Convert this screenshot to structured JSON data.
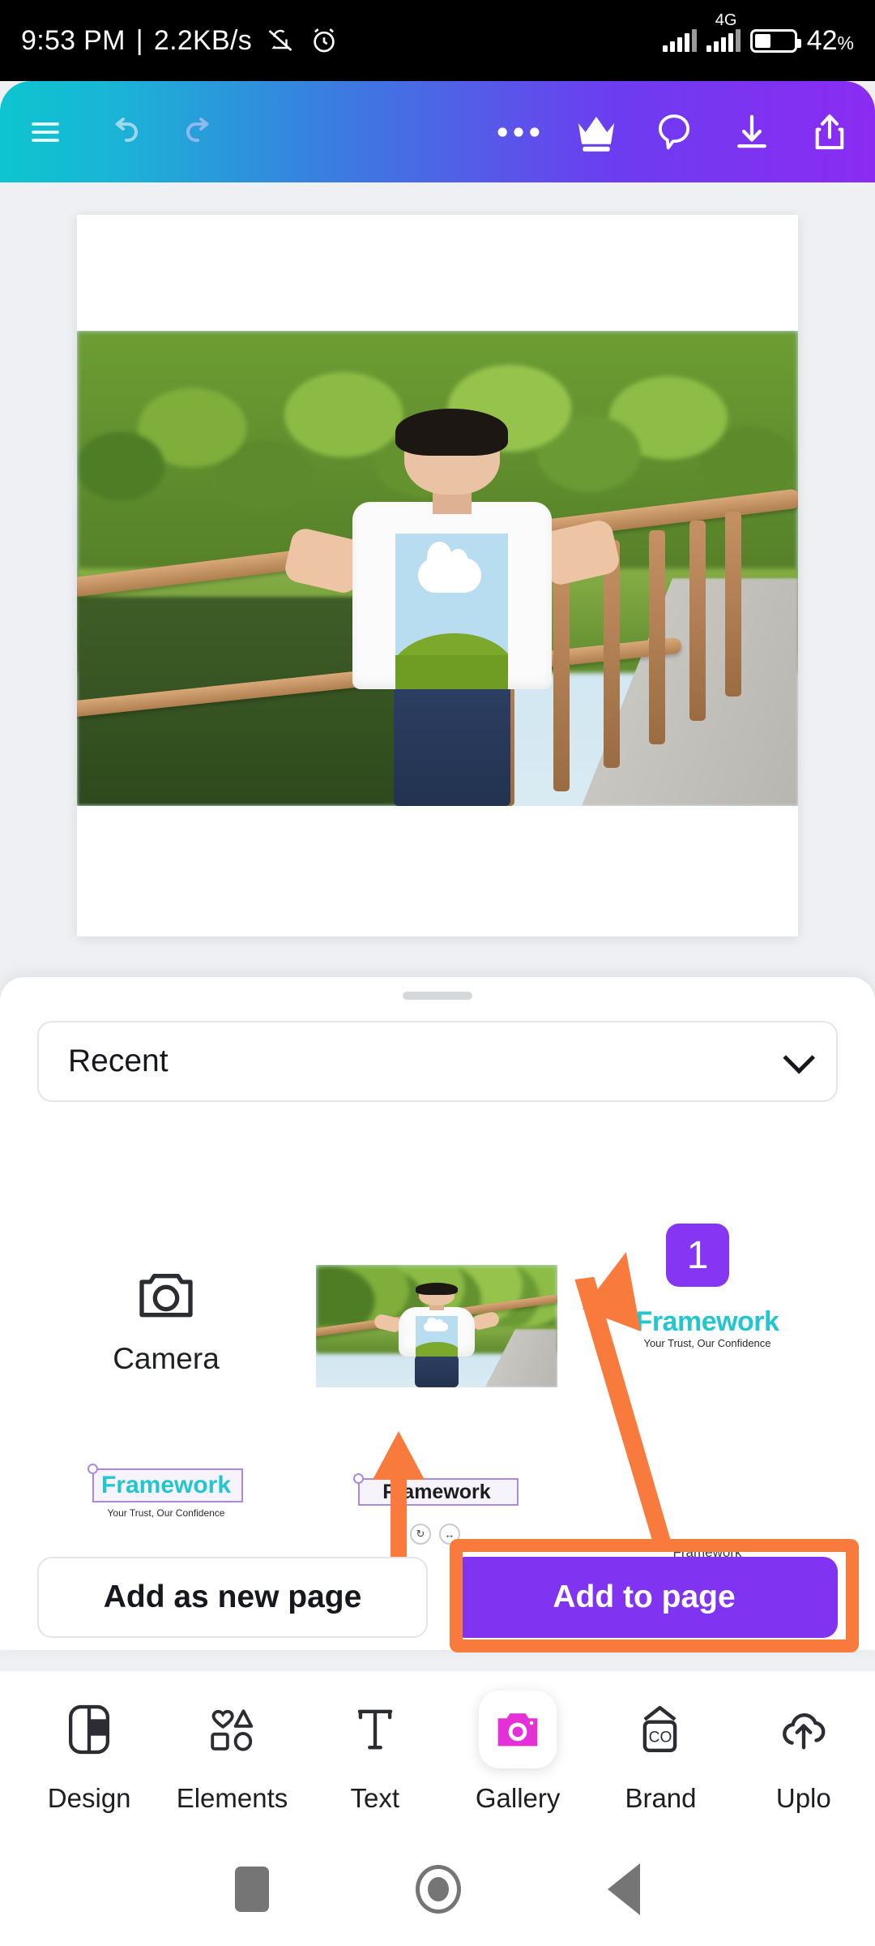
{
  "status_bar": {
    "time": "9:53 PM",
    "separator": "|",
    "network_speed": "2.2KB/s",
    "mute_icon": "bell-muted-icon",
    "alarm_icon": "alarm-clock-icon",
    "signal_icon": "signal-bars-icon",
    "network_type": "4G",
    "battery_icon": "battery-icon",
    "battery_percent": "42",
    "battery_percent_symbol": "%"
  },
  "toolbar": {
    "menu_icon": "hamburger-menu-icon",
    "undo_icon": "undo-icon",
    "redo_icon": "redo-icon",
    "more_icon": "more-options-icon",
    "crown_icon": "crown-premium-icon",
    "comment_icon": "comment-bubble-icon",
    "download_icon": "download-icon",
    "share_icon": "share-upload-icon",
    "gradient_start": "#0dc5cf",
    "gradient_end": "#8b2bf2"
  },
  "canvas": {
    "page_label": "design-canvas-page",
    "photo_description": "photo-young-man-on-wooden-bridge"
  },
  "sheet": {
    "grabber": "drag-handle",
    "dropdown": {
      "value": "Recent",
      "chevron_icon": "chevron-down-icon"
    },
    "grid": {
      "row1": [
        {
          "type": "camera",
          "label": "Camera",
          "icon": "camera-icon"
        },
        {
          "type": "photo",
          "label": "photo-thumbnail-bridge"
        },
        {
          "type": "design",
          "badge": "1",
          "title": "Framework",
          "subtitle": "Your Trust, Our Confidence"
        }
      ],
      "row2": [
        {
          "type": "design",
          "title": "Framework",
          "subtitle": "Your Trust, Our Confidence"
        },
        {
          "type": "design",
          "title": "Framework",
          "subtitle": ""
        },
        {
          "type": "design",
          "title": "Framework",
          "subtitle": ""
        }
      ]
    },
    "buttons": {
      "secondary_label": "Add as new page",
      "primary_label": "Add to page",
      "primary_color": "#8034f2"
    }
  },
  "annotations": {
    "highlight_color": "#f97a3d",
    "highlight_target": "add-to-page-button",
    "arrow_long": "orange-arrow-pointing-to-framework-thumbnail",
    "arrow_short": "orange-arrow-pointing-to-framework-text"
  },
  "bottom_nav": {
    "items": [
      {
        "label": "Design",
        "icon": "layout-design-icon",
        "active": false
      },
      {
        "label": "Elements",
        "icon": "shapes-elements-icon",
        "active": false
      },
      {
        "label": "Text",
        "icon": "text-t-icon",
        "active": false
      },
      {
        "label": "Gallery",
        "icon": "camera-gallery-icon",
        "active": true
      },
      {
        "label": "Brand",
        "icon": "brand-co-icon",
        "active": false
      },
      {
        "label": "Uplo",
        "icon": "upload-cloud-icon",
        "active": false
      }
    ],
    "active_color": "#e530d8"
  },
  "android_nav": {
    "recents_icon": "recents-square-icon",
    "home_icon": "home-circle-icon",
    "back_icon": "back-triangle-icon"
  }
}
